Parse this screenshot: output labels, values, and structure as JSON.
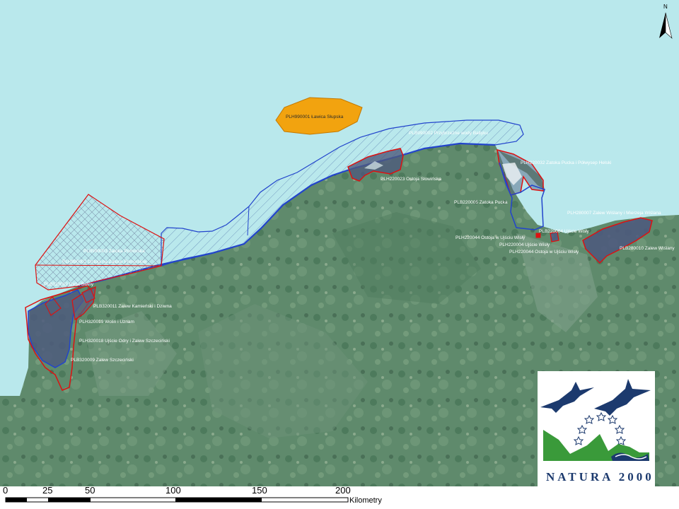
{
  "map": {
    "colors": {
      "sea": "#b9e8ec",
      "land": "#5f8a6c",
      "spa_outline": "#2244cc",
      "sci_outline": "#dd1111",
      "offshore_fill": "#f2a30f"
    },
    "sites": [
      {
        "key": "lawica",
        "label": "PLH990001 Ławica Słupska"
      },
      {
        "key": "przybrzezne",
        "label": "PLB990002 Przybrzeżne wody Bałtyku"
      },
      {
        "key": "zatoka_pom_b",
        "label": "PLB990003 Zatoka Pomorska"
      },
      {
        "key": "zatoka_pom_h",
        "label": "PLH990002 Ostoja na Zatoce Pomorskiej"
      },
      {
        "key": "delta_swiny",
        "label": "PLB320002 Delta Świny"
      },
      {
        "key": "zalew_kam",
        "label": "PLB320011 Zalew Kamieński i Dziwna"
      },
      {
        "key": "wolin",
        "label": "PLH320019 Wolin i Uznam"
      },
      {
        "key": "ujscie_odry",
        "label": "PLH320018 Ujście Odry i Zalew Szczeciński"
      },
      {
        "key": "zalew_szcz",
        "label": "PLB320009 Zalew Szczeciński"
      },
      {
        "key": "slowinska",
        "label": "PLH220023 Ostoja Słowińska"
      },
      {
        "key": "zatoka_pucka_h",
        "label": "PLH220032 Zatoka Pucka i Półwysep Helski"
      },
      {
        "key": "zatoka_pucka_b",
        "label": "PLB220005 Zatoka Pucka"
      },
      {
        "key": "ujscie_wisly_b",
        "label": "PLB220004 Ujście Wisły"
      },
      {
        "key": "ostoja_ujscie_a",
        "label": "PLH220044 Ostoja w Ujściu Wisły"
      },
      {
        "key": "ostoja_ujscie_c",
        "label": "PLH220004 Ujście Wisły"
      },
      {
        "key": "ostoja_ujscie_b",
        "label": "PLH220044 Ostoja w Ujściu Wisły"
      },
      {
        "key": "mierzeja",
        "label": "PLH280007 Zalew Wiślany i Mierzeja Wiślana"
      },
      {
        "key": "zalew_wislany",
        "label": "PLB280010 Zalew Wiślany"
      }
    ],
    "north_arrow": {
      "label": "N"
    },
    "scale_bar": {
      "ticks": [
        "0",
        "25",
        "50",
        "100",
        "150",
        "200"
      ],
      "unit": "Kilometry"
    },
    "logo": {
      "text": "NATURA 2000",
      "icon": "natura-2000-logo"
    }
  }
}
